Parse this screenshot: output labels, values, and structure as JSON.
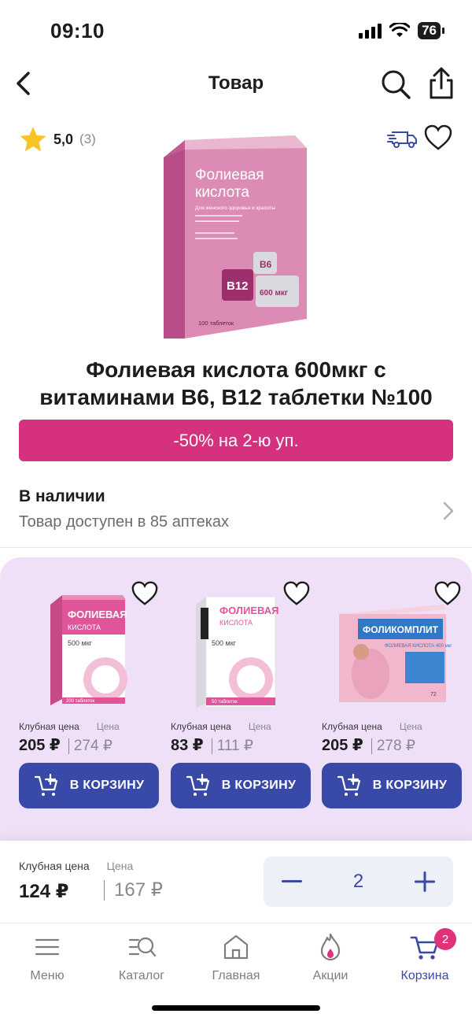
{
  "status_bar": {
    "time": "09:10",
    "battery": "76"
  },
  "header": {
    "title": "Товар"
  },
  "product": {
    "rating": "5,0",
    "review_count": "(3)",
    "title_line1": "Фолиевая кислота 600мкг с",
    "title_line2": "витаминами В6, В12 таблетки №100",
    "package": {
      "brand_line1": "Фолиевая",
      "brand_line2": "кислота",
      "subtitle": "Для женского здоровья и красоты",
      "b12": "B12",
      "b6": "B6",
      "dose": "600 мкг",
      "count": "100 таблеток"
    },
    "promo": "-50% на 2-ю уп.",
    "availability_title": "В наличии",
    "availability_sub": "Товар доступен в 85 аптеках"
  },
  "related": {
    "club_label": "Клубная цена",
    "price_label": "Цена",
    "cart_label": "В КОРЗИНУ",
    "items": [
      {
        "club_price": "205 ₽",
        "price": "274 ₽",
        "pack_name_1": "ФОЛИЕВАЯ",
        "pack_name_2": "КИСЛОТА",
        "pack_dose": "500 мкг",
        "pack_count": "200 таблеток"
      },
      {
        "club_price": "83 ₽",
        "price": "111 ₽",
        "pack_name_1": "ФОЛИЕВАЯ",
        "pack_name_2": "КИСЛОТА",
        "pack_dose": "500 мкг",
        "pack_count": "50 таблеток"
      },
      {
        "club_price": "205 ₽",
        "price": "278 ₽",
        "pack_name_1": "ФОЛИКОМПЛИТ",
        "pack_name_2": "ФОЛИЕВАЯ КИСЛОТА 400 мкг",
        "pack_dose": "",
        "pack_count": "72"
      }
    ]
  },
  "buy_bar": {
    "club_label": "Клубная цена",
    "price_label": "Цена",
    "club_price": "124 ₽",
    "price": "167 ₽",
    "quantity": "2"
  },
  "tab_bar": {
    "items": [
      {
        "label": "Меню"
      },
      {
        "label": "Каталог"
      },
      {
        "label": "Главная"
      },
      {
        "label": "Акции"
      },
      {
        "label": "Корзина"
      }
    ],
    "cart_badge": "2"
  },
  "colors": {
    "accent": "#3949a8",
    "promo": "#d6317f",
    "related_bg": "#efdff7"
  }
}
